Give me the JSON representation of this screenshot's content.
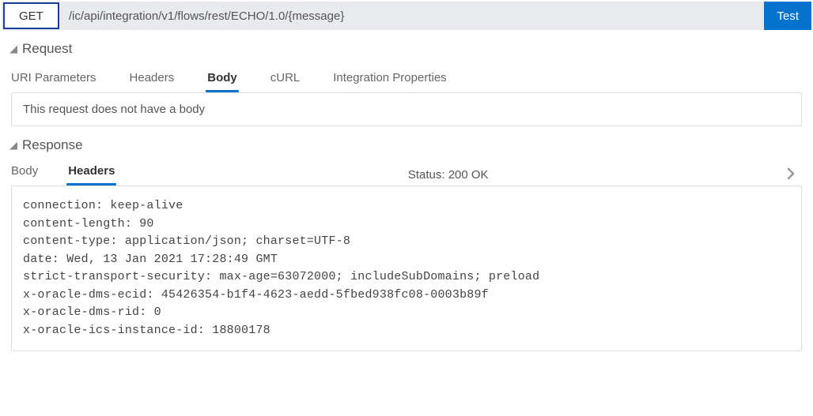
{
  "urlBar": {
    "method": "GET",
    "path": "/ic/api/integration/v1/flows/rest/ECHO/1.0/{message}",
    "testLabel": "Test"
  },
  "request": {
    "title": "Request",
    "tabs": {
      "uriParams": "URI Parameters",
      "headers": "Headers",
      "body": "Body",
      "curl": "cURL",
      "integration": "Integration Properties"
    },
    "bodyMessage": "This request does not have a body"
  },
  "response": {
    "title": "Response",
    "tabs": {
      "body": "Body",
      "headers": "Headers"
    },
    "status": "Status: 200 OK",
    "headersContent": "connection: keep-alive\ncontent-length: 90\ncontent-type: application/json; charset=UTF-8\ndate: Wed, 13 Jan 2021 17:28:49 GMT\nstrict-transport-security: max-age=63072000; includeSubDomains; preload\nx-oracle-dms-ecid: 45426354-b1f4-4623-aedd-5fbed938fc08-0003b89f\nx-oracle-dms-rid: 0\nx-oracle-ics-instance-id: 18800178"
  }
}
